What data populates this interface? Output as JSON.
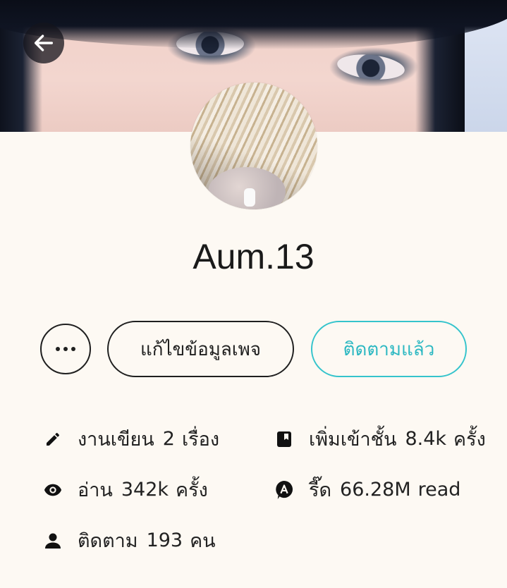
{
  "header": {
    "back_icon": "arrow-left-icon"
  },
  "profile": {
    "name": "Aum.13"
  },
  "actions": {
    "more_icon": "more-horizontal-icon",
    "edit_label": "แก้ไขข้อมูลเพจ",
    "follow_label": "ติดตามแล้ว",
    "follow_color": "#2cb8c2"
  },
  "stats": {
    "works": {
      "icon": "pencil-icon",
      "label": "งานเขียน",
      "value": "2",
      "unit": "เรื่อง"
    },
    "shelf": {
      "icon": "bookmark-book-icon",
      "label": "เพิ่มเข้าชั้น",
      "value": "8.4k",
      "unit": "ครั้ง"
    },
    "reads": {
      "icon": "eye-icon",
      "label": "อ่าน",
      "value": "342k",
      "unit": "ครั้ง"
    },
    "readcoin": {
      "icon": "readawrite-badge-icon",
      "label": "รี๊ด",
      "value": "66.28M",
      "unit": "read"
    },
    "followers": {
      "icon": "person-icon",
      "label": "ติดตาม",
      "value": "193",
      "unit": "คน"
    }
  }
}
